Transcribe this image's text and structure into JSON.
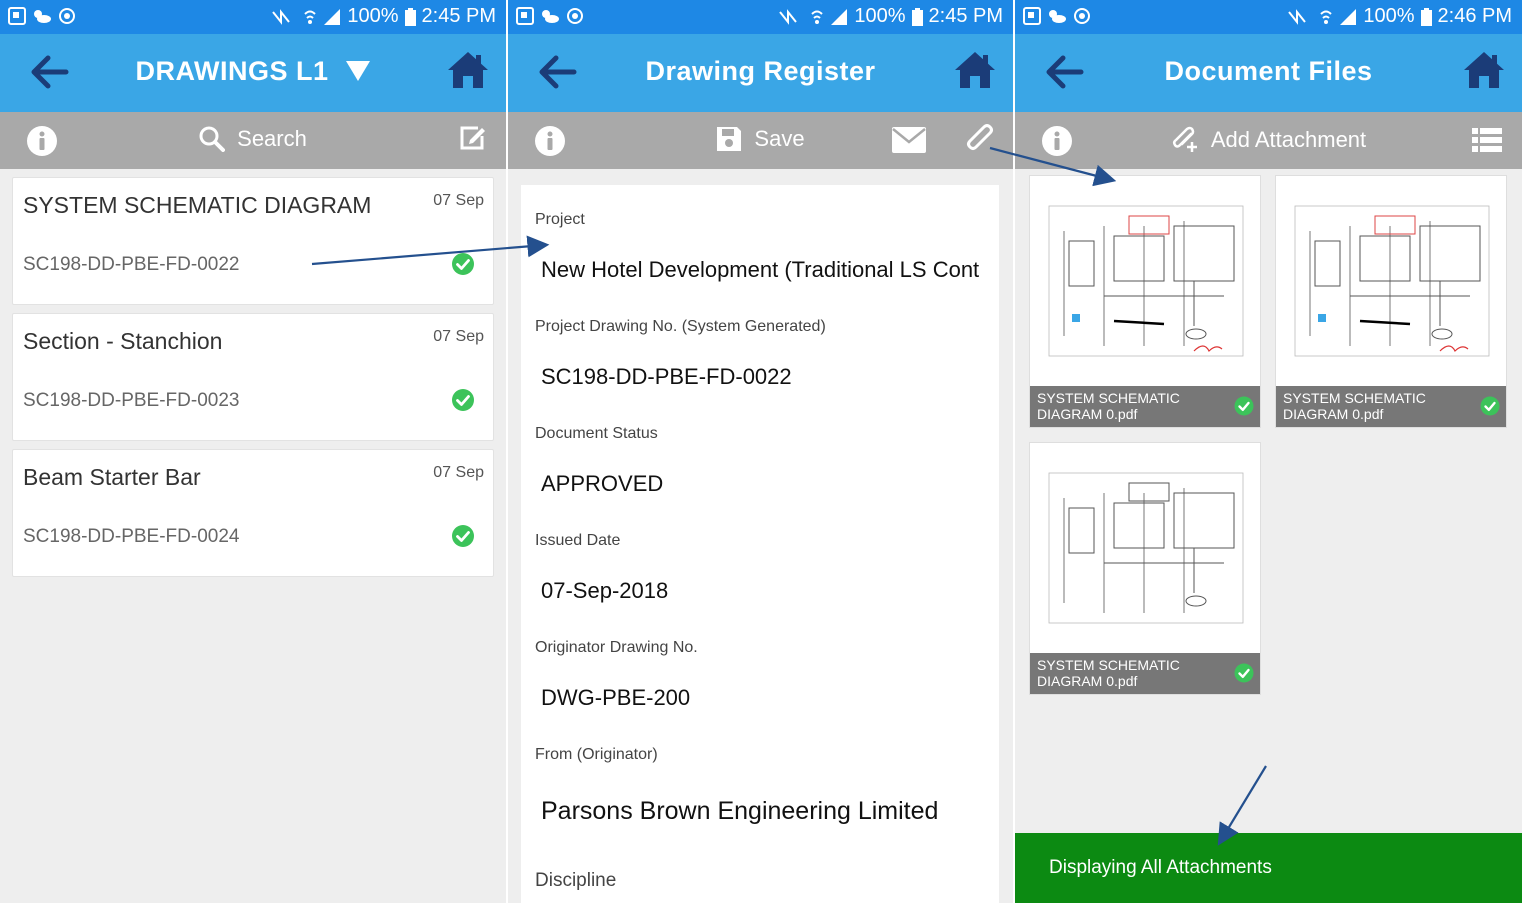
{
  "status_bars": [
    {
      "battery": "100%",
      "time": "2:45 PM"
    },
    {
      "battery": "100%",
      "time": "2:45 PM"
    },
    {
      "battery": "100%",
      "time": "2:46 PM"
    }
  ],
  "panel1": {
    "title": "DRAWINGS  L1",
    "toolbar": {
      "search_label": "Search"
    },
    "items": [
      {
        "title": "SYSTEM SCHEMATIC DIAGRAM",
        "date": "07 Sep",
        "code": "SC198-DD-PBE-FD-0022"
      },
      {
        "title": "Section - Stanchion",
        "date": "07 Sep",
        "code": "SC198-DD-PBE-FD-0023"
      },
      {
        "title": "Beam Starter Bar",
        "date": "07 Sep",
        "code": "SC198-DD-PBE-FD-0024"
      }
    ]
  },
  "panel2": {
    "title": "Drawing Register",
    "toolbar": {
      "save_label": "Save"
    },
    "fields": [
      {
        "label": "Project",
        "value": "New Hotel Development (Traditional LS Cont"
      },
      {
        "label": "Project Drawing No. (System Generated)",
        "value": "SC198-DD-PBE-FD-0022"
      },
      {
        "label": "Document Status",
        "value": "APPROVED"
      },
      {
        "label": "Issued Date",
        "value": "07-Sep-2018"
      },
      {
        "label": "Originator Drawing No.",
        "value": "DWG-PBE-200"
      },
      {
        "label": "From (Originator)",
        "value": "Parsons Brown Engineering Limited"
      },
      {
        "label": "Discipline",
        "value": ""
      }
    ]
  },
  "panel3": {
    "title": "Document Files",
    "toolbar": {
      "add_label": "Add Attachment"
    },
    "files": [
      {
        "name": "SYSTEM SCHEMATIC DIAGRAM 0.pdf"
      },
      {
        "name": "SYSTEM SCHEMATIC DIAGRAM 0.pdf"
      },
      {
        "name": "SYSTEM SCHEMATIC DIAGRAM 0.pdf"
      }
    ],
    "footer": "Displaying All Attachments"
  },
  "colors": {
    "status_bar": "#1e88e5",
    "app_bar": "#3aa6e6",
    "toolbar": "#a9a9a9",
    "check": "#3cc35a",
    "footer": "#0c8a12",
    "arrow": "#24508e"
  }
}
